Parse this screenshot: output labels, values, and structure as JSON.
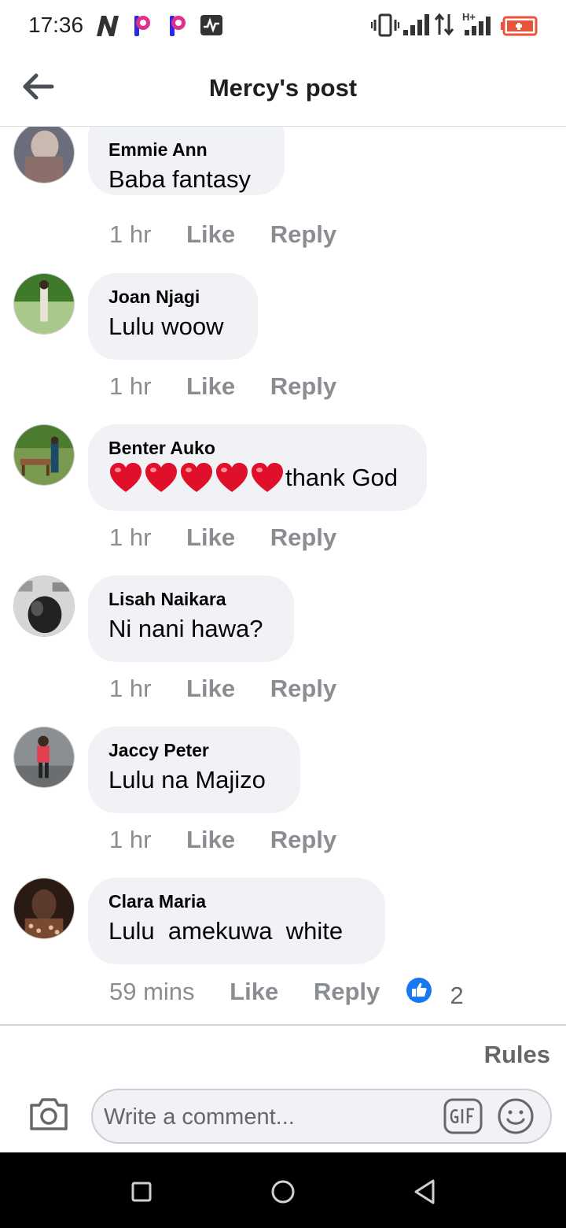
{
  "status_bar": {
    "time": "17:36",
    "left_icons": [
      "n-logo-icon",
      "p-app-icon",
      "p-app-icon",
      "activity-icon"
    ],
    "right_icons": [
      "vibrate-icon",
      "signal-icon",
      "data-arrows-icon",
      "signal-hplus-icon",
      "battery-low-icon"
    ],
    "network_label": "H+"
  },
  "header": {
    "title": "Mercy's post"
  },
  "comments": [
    {
      "author": "Emmie Ann",
      "text": "Baba fantasy",
      "time": "1 hr",
      "like": "Like",
      "reply": "Reply",
      "avatar_colors": [
        "#6b6d7a",
        "#c9b9b0"
      ]
    },
    {
      "author": "Joan Njagi",
      "text": "Lulu woow",
      "time": "1 hr",
      "like": "Like",
      "reply": "Reply",
      "avatar_colors": [
        "#3f7a2a",
        "#a8c98a"
      ]
    },
    {
      "author": "Benter Auko",
      "text": "thank God",
      "hearts": 5,
      "time": "1 hr",
      "like": "Like",
      "reply": "Reply",
      "avatar_colors": [
        "#4d7b2f",
        "#8a5a3a"
      ]
    },
    {
      "author": "Lisah Naikara",
      "text": "Ni nani hawa?",
      "time": "1 hr",
      "like": "Like",
      "reply": "Reply",
      "avatar_colors": [
        "#222222",
        "#d6d6d6"
      ]
    },
    {
      "author": "Jaccy Peter",
      "text": "Lulu na Majizo",
      "time": "1 hr",
      "like": "Like",
      "reply": "Reply",
      "avatar_colors": [
        "#8a8f92",
        "#e04050"
      ]
    },
    {
      "author": "Clara Maria",
      "text": "Lulu  amekuwa  white",
      "time": "59 mins",
      "like": "Like",
      "reply": "Reply",
      "reaction_count": "2",
      "avatar_colors": [
        "#2a1a14",
        "#7a4a30"
      ]
    }
  ],
  "rules_label": "Rules",
  "composer": {
    "placeholder": "Write a comment..."
  },
  "colors": {
    "bubble": "#f0f2f5",
    "meta_text": "#8a8d91",
    "like_blue": "#1877f2",
    "heart_red": "#e0102a"
  },
  "nav_bar": {
    "buttons": [
      "recents-square-icon",
      "home-circle-icon",
      "back-triangle-icon"
    ]
  }
}
